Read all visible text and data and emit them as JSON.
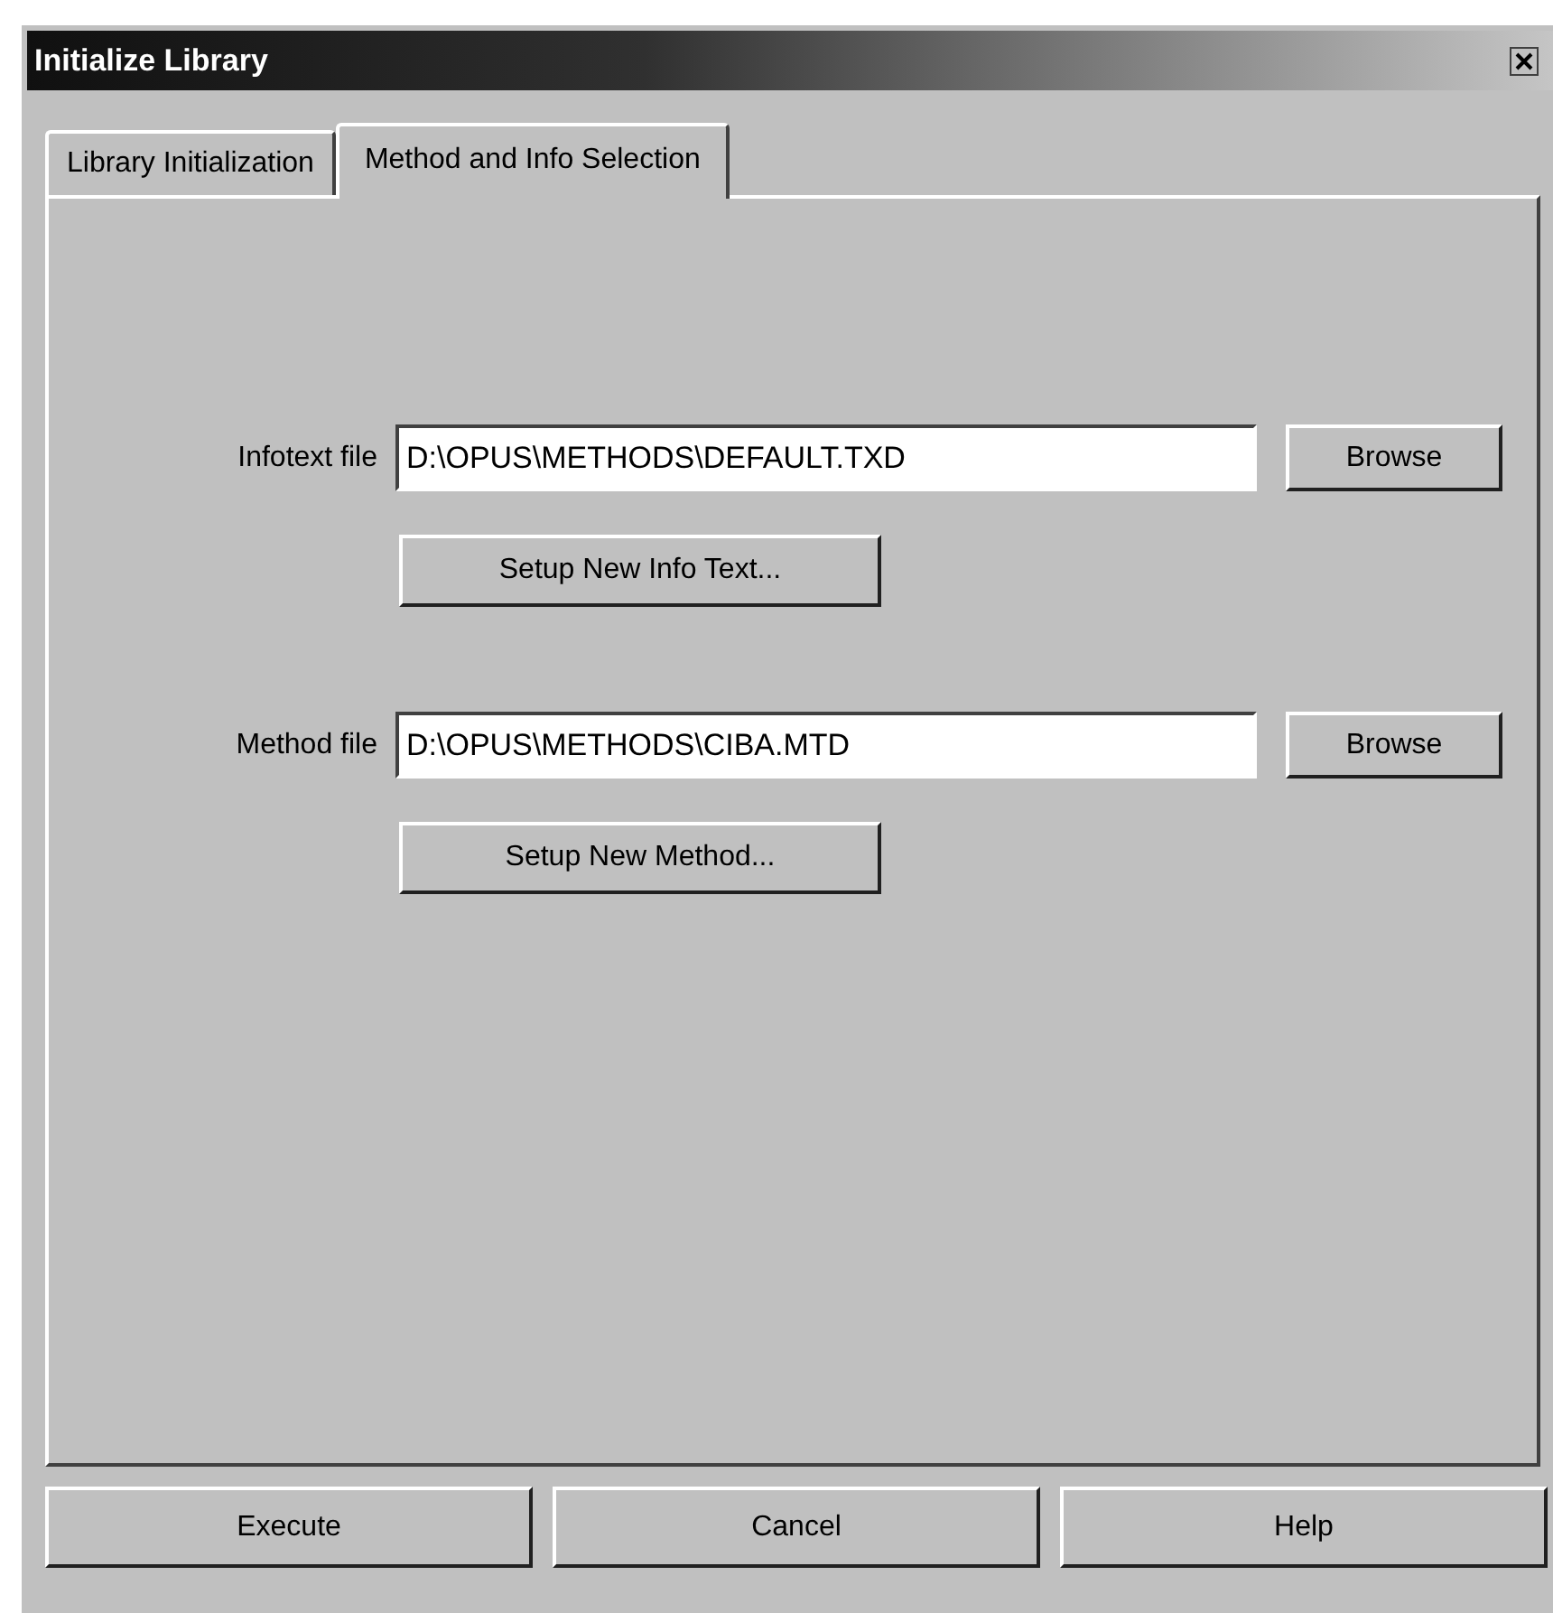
{
  "window": {
    "title": "Initialize Library"
  },
  "tabs": [
    {
      "label": "Library Initialization",
      "selected": false
    },
    {
      "label": "Method and Info Selection",
      "selected": true
    }
  ],
  "files": [
    {
      "label": "Infotext file",
      "value": "D:\\OPUS\\METHODS\\DEFAULT.TXD",
      "browse": "Browse",
      "setup": "Setup New Info Text..."
    },
    {
      "label": "Method file",
      "value": "D:\\OPUS\\METHODS\\CIBA.MTD",
      "browse": "Browse",
      "setup": "Setup New Method..."
    }
  ],
  "buttons": [
    "Execute",
    "Cancel",
    "Help"
  ]
}
